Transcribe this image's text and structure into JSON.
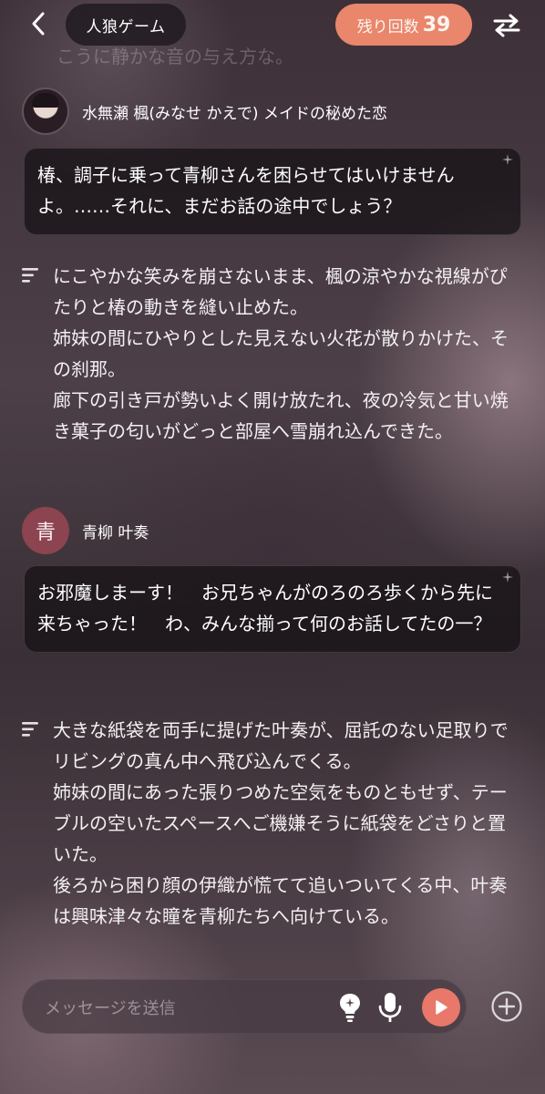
{
  "header": {
    "title": "人狼ゲーム",
    "remaining_label": "残り回数",
    "remaining_count": "39"
  },
  "faded_line": "こうに静かな音の与え方な。",
  "messages": [
    {
      "speaker": "水無瀬 楓(みなせ かえで) メイドの秘めた恋",
      "text": "椿、調子に乗って青柳さんを困らせてはいけませんよ。……それに、まだお話の途中でしょう？"
    },
    {
      "narration": [
        "にこやかな笑みを崩さないまま、楓の涼やかな視線がぴたりと椿の動きを縫い止めた。",
        "姉妹の間にひやりとした見えない火花が散りかけた、その刹那。",
        "廊下の引き戸が勢いよく開け放たれ、夜の冷気と甘い焼き菓子の匂いがどっと部屋へ雪崩れ込んできた。"
      ]
    },
    {
      "speaker": "青柳 叶奏",
      "avatar_letter": "青",
      "text": "お邪魔しまーす！　お兄ちゃんがのろのろ歩くから先に来ちゃった！　わ、みんな揃って何のお話してたの一？"
    },
    {
      "narration": [
        "大きな紙袋を両手に提げた叶奏が、屈託のない足取りでリビングの真ん中へ飛び込んでくる。",
        "姉妹の間にあった張りつめた空気をものともせず、テーブルの空いたスペースへご機嫌そうに紙袋をどさりと置いた。",
        "後ろから困り顔の伊織が慌てて追いついてくる中、叶奏は興味津々な瞳を青柳たちへ向けている。"
      ]
    }
  ],
  "input": {
    "placeholder": "メッセージを送信"
  },
  "icons": {
    "back": "chevron-left-icon",
    "swap": "swap-arrows-icon",
    "sparkle": "sparkle-icon",
    "narration": "narration-lines-icon",
    "hint": "lightbulb-icon",
    "mic": "microphone-icon",
    "send": "play-icon",
    "add": "plus-circle-icon"
  },
  "colors": {
    "accent": "#e9866b",
    "send": "#e9786a",
    "avatar_letter_bg": "#8b4450"
  }
}
